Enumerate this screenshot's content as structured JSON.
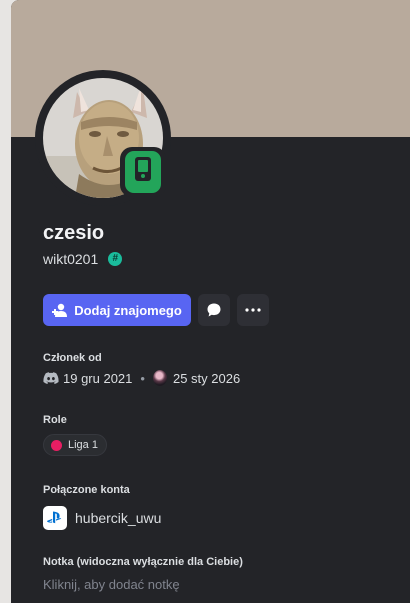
{
  "profile": {
    "display_name": "czesio",
    "username": "wikt0201",
    "badge_symbol": "#",
    "status": "mobile-online",
    "status_color": "#23a55a",
    "banner_color": "#b8aa9c"
  },
  "actions": {
    "add_friend_label": "Dodaj znajomego",
    "message_icon": "chat-bubble-icon",
    "more_icon": "more-dots-icon",
    "accent_color": "#5865f2"
  },
  "member_since": {
    "title": "Członek od",
    "discord_icon": "discord-icon",
    "discord_date": "19 gru 2021",
    "separator": "•",
    "server_date": "25 sty 2026"
  },
  "roles": {
    "title": "Role",
    "items": [
      {
        "name": "Liga 1",
        "color": "#e91e63"
      }
    ]
  },
  "connections": {
    "title": "Połączone konta",
    "items": [
      {
        "service_icon": "playstation-icon",
        "name": "hubercik_uwu"
      }
    ]
  },
  "note": {
    "title": "Notka (widoczna wyłącznie dla Ciebie)",
    "placeholder": "Kliknij, aby dodać notkę"
  }
}
